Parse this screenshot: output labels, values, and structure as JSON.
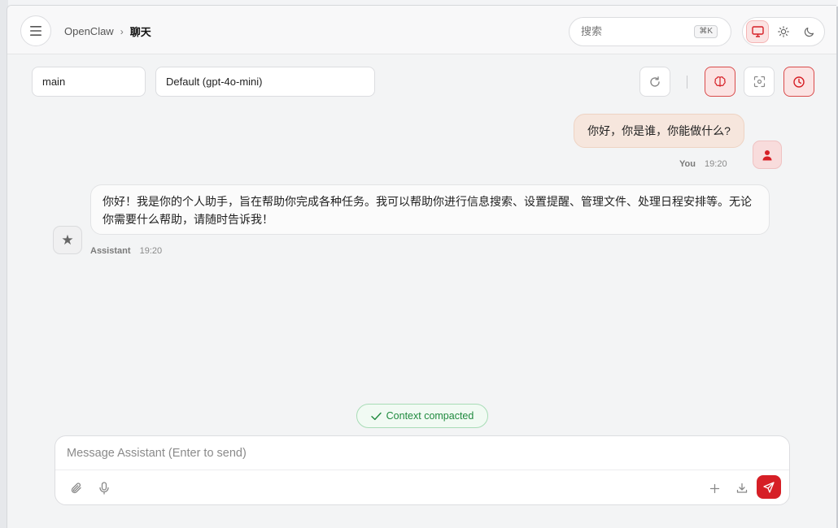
{
  "header": {
    "breadcrumb_root": "OpenClaw",
    "breadcrumb_separator": "›",
    "breadcrumb_current": "聊天",
    "search_placeholder": "搜索",
    "search_shortcut": "⌘K"
  },
  "controls": {
    "session_value": "main",
    "model_value": "Default (gpt-4o-mini)"
  },
  "messages": [
    {
      "role": "user",
      "text": "你好，你是谁，你能做什么?",
      "name": "You",
      "time": "19:20"
    },
    {
      "role": "assistant",
      "text": "你好！我是你的个人助手，旨在帮助你完成各种任务。我可以帮助你进行信息搜索、设置提醒、管理文件、处理日程安排等。无论你需要什么帮助，请随时告诉我！",
      "name": "Assistant",
      "time": "19:20"
    }
  ],
  "status": {
    "compacted_label": "Context compacted"
  },
  "composer": {
    "placeholder": "Message Assistant (Enter to send)",
    "value": ""
  },
  "icons": {
    "menu": "menu-icon",
    "theme_system": "monitor-icon",
    "theme_light": "sun-icon",
    "theme_dark": "moon-icon",
    "refresh": "refresh-icon",
    "brain": "brain-icon",
    "focus": "focus-icon",
    "clock": "clock-icon",
    "user_avatar": "user-icon",
    "assistant_avatar": "star-icon",
    "attach": "paperclip-icon",
    "mic": "microphone-icon",
    "add": "plus-icon",
    "download": "download-icon",
    "send": "send-icon"
  },
  "colors": {
    "accent": "#d61f26",
    "user_bubble": "#f6e6dd",
    "success": "#1f8a3e"
  }
}
